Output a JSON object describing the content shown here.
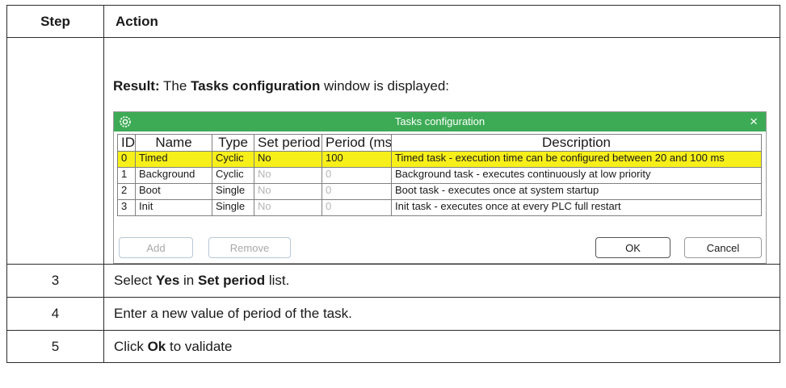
{
  "header": {
    "step": "Step",
    "action": "Action"
  },
  "result": {
    "label": "Result:",
    "text1": " The ",
    "window_name": "Tasks configuration",
    "text2": " window is displayed:"
  },
  "dialog": {
    "title": "Tasks configuration",
    "close_label": "×",
    "columns": [
      "ID",
      "Name",
      "Type",
      "Set period",
      "Period (ms)",
      "Description"
    ],
    "rows": [
      {
        "id": "0",
        "name": "Timed",
        "type": "Cyclic",
        "set_period": "No",
        "period": "100",
        "description": "Timed task - execution time can be configured between 20 and 100 ms"
      },
      {
        "id": "1",
        "name": "Background",
        "type": "Cyclic",
        "set_period": "No",
        "period": "0",
        "description": "Background task - executes continuously at low priority"
      },
      {
        "id": "2",
        "name": "Boot",
        "type": "Single",
        "set_period": "No",
        "period": "0",
        "description": "Boot task - executes once at system startup"
      },
      {
        "id": "3",
        "name": "Init",
        "type": "Single",
        "set_period": "No",
        "period": "0",
        "description": "Init task - executes once at every PLC full restart"
      }
    ],
    "buttons": {
      "add": "Add",
      "remove": "Remove",
      "ok": "OK",
      "cancel": "Cancel"
    },
    "titlebar_color": "#3dab55",
    "selection_color": "#f7ef1a"
  },
  "steps": [
    {
      "num": "3",
      "parts": [
        "Select ",
        "Yes",
        " in ",
        "Set period",
        " list."
      ]
    },
    {
      "num": "4",
      "text": "Enter a new value of period of the task."
    },
    {
      "num": "5",
      "parts": [
        "Click ",
        "Ok",
        " to validate"
      ]
    }
  ]
}
